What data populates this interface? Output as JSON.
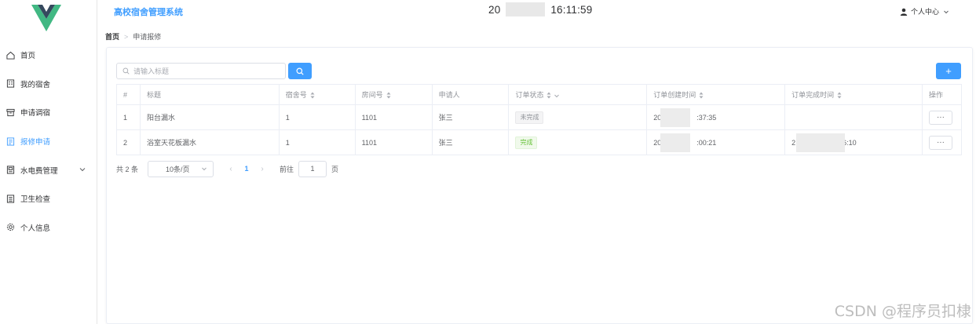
{
  "header": {
    "app_title": "高校宿舍管理系统",
    "clock_prefix": "20",
    "clock_time": "16:11:59",
    "user_menu_label": "个人中心"
  },
  "sidebar": {
    "items": [
      {
        "label": "首页",
        "icon": "home-icon",
        "active": false
      },
      {
        "label": "我的宿舍",
        "icon": "building-icon",
        "active": false
      },
      {
        "label": "申请调宿",
        "icon": "box-icon",
        "active": false
      },
      {
        "label": "报修申请",
        "icon": "document-icon",
        "active": true
      },
      {
        "label": "水电费管理",
        "icon": "meter-icon",
        "active": false,
        "has_submenu": true
      },
      {
        "label": "卫生检查",
        "icon": "list-icon",
        "active": false
      },
      {
        "label": "个人信息",
        "icon": "gear-icon",
        "active": false
      }
    ]
  },
  "breadcrumb": {
    "home": "首页",
    "current": "申请报修"
  },
  "search": {
    "placeholder": "请输入标题"
  },
  "table": {
    "columns": [
      "#",
      "标题",
      "宿舍号",
      "房间号",
      "申请人",
      "订单状态",
      "订单创建时间",
      "订单完成时间",
      "操作"
    ],
    "rows": [
      {
        "index": "1",
        "title": "阳台漏水",
        "dorm": "1",
        "room": "1101",
        "applicant": "张三",
        "status": "未完成",
        "status_type": "info",
        "created_prefix": "20",
        "created_suffix": ":37:35",
        "finished_prefix": "",
        "finished_suffix": "",
        "ops": "···"
      },
      {
        "index": "2",
        "title": "浴室天花板漏水",
        "dorm": "1",
        "room": "1101",
        "applicant": "张三",
        "status": "完成",
        "status_type": "success",
        "created_prefix": "20",
        "created_suffix": ":00:21",
        "finished_prefix": "2",
        "finished_suffix": "6:10",
        "ops": "···"
      }
    ]
  },
  "pagination": {
    "total_text": "共 2 条",
    "page_size": "10条/页",
    "current_page": "1",
    "goto_label": "前往",
    "goto_value": "1",
    "page_unit": "页"
  },
  "watermark": "CSDN @程序员扣棣",
  "colors": {
    "primary": "#409eff",
    "success": "#67c23a",
    "logo_green": "#41b883",
    "logo_dark": "#35495e"
  }
}
